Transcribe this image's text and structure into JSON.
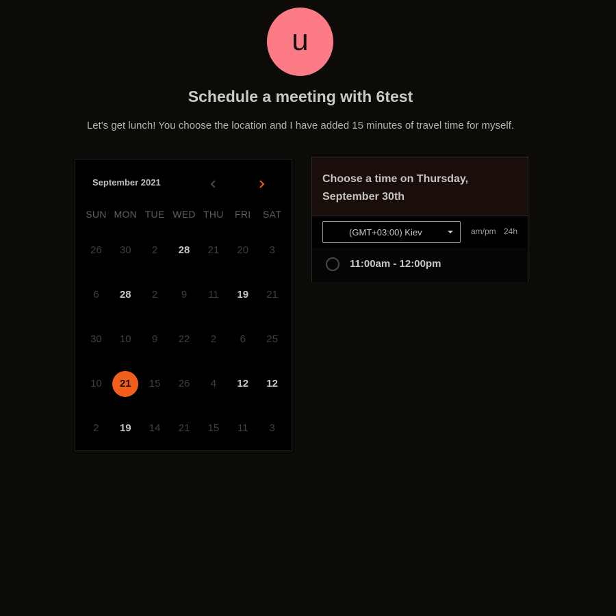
{
  "avatar": {
    "initial": "u",
    "color": "#fc7b86"
  },
  "header": {
    "title": "Schedule a meeting with 6test",
    "description": "Let's get lunch! You choose the location and I have added 15 minutes of travel time for myself."
  },
  "calendar": {
    "month_label": "September 2021",
    "prev_icon": "chevron-left-icon",
    "next_icon": "chevron-right-icon",
    "accent_color": "#f25e1c",
    "weekdays": [
      "SUN",
      "MON",
      "TUE",
      "WED",
      "THU",
      "FRI",
      "SAT"
    ],
    "weeks": [
      [
        {
          "d": "26",
          "a": false
        },
        {
          "d": "30",
          "a": false
        },
        {
          "d": "2",
          "a": false
        },
        {
          "d": "28",
          "a": true
        },
        {
          "d": "21",
          "a": false
        },
        {
          "d": "20",
          "a": false
        },
        {
          "d": "3",
          "a": false
        }
      ],
      [
        {
          "d": "6",
          "a": false
        },
        {
          "d": "28",
          "a": true
        },
        {
          "d": "2",
          "a": false
        },
        {
          "d": "9",
          "a": false
        },
        {
          "d": "11",
          "a": false
        },
        {
          "d": "19",
          "a": true
        },
        {
          "d": "21",
          "a": false
        }
      ],
      [
        {
          "d": "30",
          "a": false
        },
        {
          "d": "10",
          "a": false
        },
        {
          "d": "9",
          "a": false
        },
        {
          "d": "22",
          "a": false
        },
        {
          "d": "2",
          "a": false
        },
        {
          "d": "6",
          "a": false
        },
        {
          "d": "25",
          "a": false
        }
      ],
      [
        {
          "d": "10",
          "a": false
        },
        {
          "d": "21",
          "a": true,
          "sel": true
        },
        {
          "d": "15",
          "a": false
        },
        {
          "d": "26",
          "a": false
        },
        {
          "d": "4",
          "a": false
        },
        {
          "d": "12",
          "a": true
        },
        {
          "d": "12",
          "a": true
        }
      ],
      [
        {
          "d": "2",
          "a": false
        },
        {
          "d": "19",
          "a": true
        },
        {
          "d": "14",
          "a": false
        },
        {
          "d": "21",
          "a": false
        },
        {
          "d": "15",
          "a": false
        },
        {
          "d": "11",
          "a": false
        },
        {
          "d": "3",
          "a": false
        }
      ]
    ]
  },
  "time_panel": {
    "heading": "Choose a time on Thursday, September 30th",
    "timezone": "(GMT+03:00) Kiev",
    "format_ampm": "am/pm",
    "format_24h": "24h",
    "slots": [
      {
        "label": "11:00am - 12:00pm"
      }
    ]
  }
}
